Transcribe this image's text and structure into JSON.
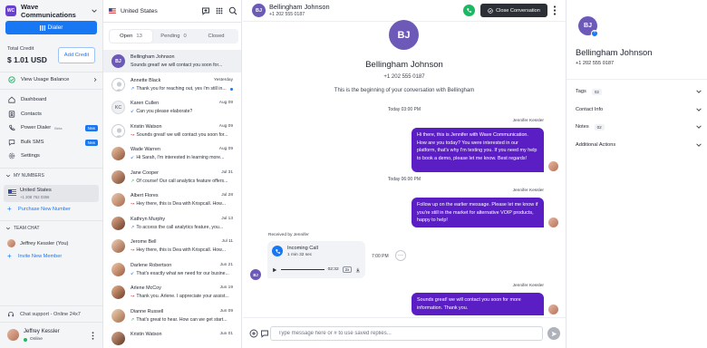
{
  "sidebar": {
    "workspace_initials": "WC",
    "workspace_name": "Wave Communications",
    "dialer_label": "Dialer",
    "total_credit_label": "Total Credit",
    "total_credit_value": "$ 1.01 USD",
    "add_credit_label": "Add Credit",
    "view_usage_label": "View Usage Balance",
    "nav": [
      {
        "label": "Dashboard",
        "icon": "dashboard-icon"
      },
      {
        "label": "Contacts",
        "icon": "contacts-icon"
      },
      {
        "label": "Power Dialer",
        "icon": "power-dialer-icon",
        "beta": "Beta",
        "badge": "New"
      },
      {
        "label": "Bulk SMS",
        "icon": "bulk-sms-icon",
        "badge": "New"
      },
      {
        "label": "Settings",
        "icon": "settings-icon"
      }
    ],
    "my_numbers_header": "MY NUMBERS",
    "number_country": "United States",
    "number_phone": "+1 208 762 0356",
    "purchase_label": "Purchase New Number",
    "team_chat_header": "TEAM CHAT",
    "team_member": "Jeffrey Kessler (You)",
    "invite_label": "Invite New Member",
    "support_label": "Chat support - Online 24x7",
    "user_name": "Jeffrey Kessler",
    "user_status": "Online"
  },
  "conversations": {
    "country": "United States",
    "tabs": [
      {
        "label": "Open",
        "count": "13"
      },
      {
        "label": "Pending",
        "count": "0"
      },
      {
        "label": "Closed",
        "count": ""
      }
    ],
    "items": [
      {
        "name": "Bellingham Johnson",
        "preview": "Sounds great! we will contact you soon for...",
        "date": "",
        "avatar": "BJ",
        "type": "initials",
        "prefix": "",
        "selected": true
      },
      {
        "name": "Annette Black",
        "preview": "Thank you for reaching out, yes i'm still in...",
        "date": "Yesterday",
        "avatar": "",
        "type": "blank",
        "prefix": "↗",
        "prefix_color": "blue",
        "unread": true
      },
      {
        "name": "Karen Cullen",
        "preview": "Can you please elaborate?",
        "date": "Aug 09",
        "avatar": "KC",
        "type": "gray",
        "prefix": "↙",
        "prefix_color": "blue"
      },
      {
        "name": "Kristin Watson",
        "preview": "Sounds great! we will contact you soon for...",
        "date": "Aug 09",
        "avatar": "",
        "type": "blank",
        "prefix": "↝",
        "prefix_color": "red"
      },
      {
        "name": "Wade Warren",
        "preview": "Hi Sarah, I'm interested in learning more...",
        "date": "Aug 09",
        "avatar": "",
        "type": "photo",
        "prefix": "↙",
        "prefix_color": "blue"
      },
      {
        "name": "Jane Cooper",
        "preview": "Of course! Our call analytics feature offers...",
        "date": "Jul 31",
        "avatar": "",
        "type": "photo",
        "prefix": "↗",
        "prefix_color": "green"
      },
      {
        "name": "Albert Flores",
        "preview": "Hey there, this is Dea with Krispcall. How...",
        "date": "Jul 28",
        "avatar": "",
        "type": "photo",
        "prefix": "↝",
        "prefix_color": "red"
      },
      {
        "name": "Kathryn Murphy",
        "preview": "To access the call analytics feature, you...",
        "date": "Jul 13",
        "avatar": "",
        "type": "photo",
        "prefix": "↗",
        "prefix_color": "blue"
      },
      {
        "name": "Jerome Bell",
        "preview": "Hey there, this is Dea with Krispcall. How...",
        "date": "Jul 11",
        "avatar": "",
        "type": "photo",
        "prefix": "↝",
        "prefix_color": "red"
      },
      {
        "name": "Darlene Robertson",
        "preview": "That's exactly what we need for our busine...",
        "date": "Jun 21",
        "avatar": "",
        "type": "photo",
        "prefix": "↙",
        "prefix_color": "blue"
      },
      {
        "name": "Arlene McCoy",
        "preview": "Thank you. Arlene. I appreciate your assist...",
        "date": "Jun 19",
        "avatar": "",
        "type": "photo",
        "prefix": "↝",
        "prefix_color": "red"
      },
      {
        "name": "Dianne Russell",
        "preview": "That's great to hear. How can we get start...",
        "date": "Jun 09",
        "avatar": "",
        "type": "photo",
        "prefix": "↗",
        "prefix_color": "green"
      },
      {
        "name": "Kristin Watson",
        "preview": "",
        "date": "Jun 01",
        "avatar": "",
        "type": "photo",
        "prefix": ""
      }
    ]
  },
  "chat": {
    "contact_initials": "BJ",
    "contact_name": "Bellingham Johnson",
    "contact_phone": "+1 202 555 0187",
    "close_label": "Close Conversation",
    "beginning_text": "This is the beginning of your conversation with Bellingham",
    "day_sep_1": "Today 03:00 PM",
    "sender_1": "Jennifer Kessler",
    "message_1": "Hi there, this is Jennifer with Wave Communication. How are you today? You were interested in our platform, that's why I'm texting you. If you need my help to book a demo, please let me know. Best regards!",
    "day_sep_2": "Today 06:00 PM",
    "sender_2": "Jennifer Kessler",
    "message_2": "Follow up on the earlier message. Please let me know if you're still in the market for alternative VOIP products, happy to help!",
    "received_by": "Received by Jennifer",
    "call_title": "Incoming Call",
    "call_duration": "1 min 32 sec",
    "call_player_time": "02:32",
    "call_speed": "2x",
    "call_time": "7:00 PM",
    "more_label": "···",
    "sender_3": "Jennifer Kessler",
    "message_3": "Sounds great! we will contact you soon for more information. Thank you.",
    "composer_placeholder": "Type message here or # to use saved replies..."
  },
  "details": {
    "initials": "BJ",
    "name": "Bellingham Johnson",
    "phone": "+1 202 555 0187",
    "sections": [
      {
        "label": "Tags",
        "count": "02"
      },
      {
        "label": "Contact Info",
        "count": ""
      },
      {
        "label": "Notes",
        "count": "02"
      },
      {
        "label": "Additional Actions",
        "count": ""
      }
    ]
  },
  "colors": {
    "accent": "#1877f2",
    "message_bubble": "#5b1ec4",
    "avatar_purple": "#6d5ab8",
    "call_green": "#1eb864"
  }
}
